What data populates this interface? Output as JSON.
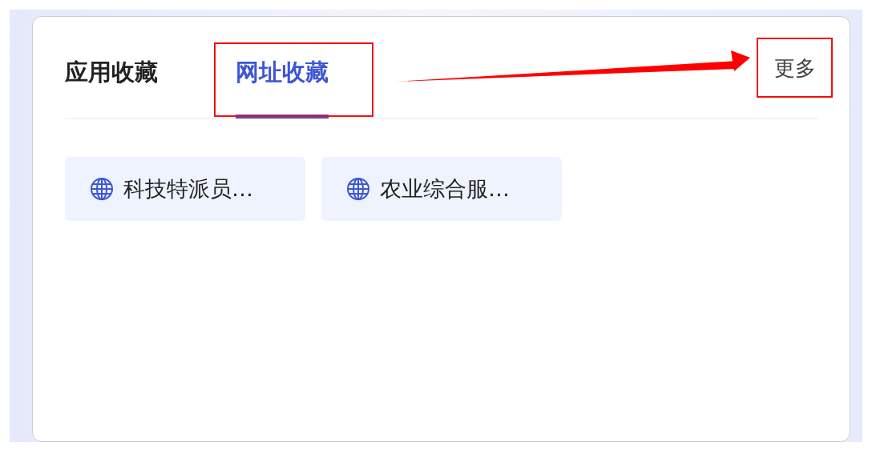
{
  "tabs": [
    {
      "label": "应用收藏",
      "selected": false
    },
    {
      "label": "网址收藏",
      "selected": true
    }
  ],
  "more_link": "更多",
  "links": [
    {
      "label": "科技特派员…"
    },
    {
      "label": "农业综合服…"
    }
  ]
}
